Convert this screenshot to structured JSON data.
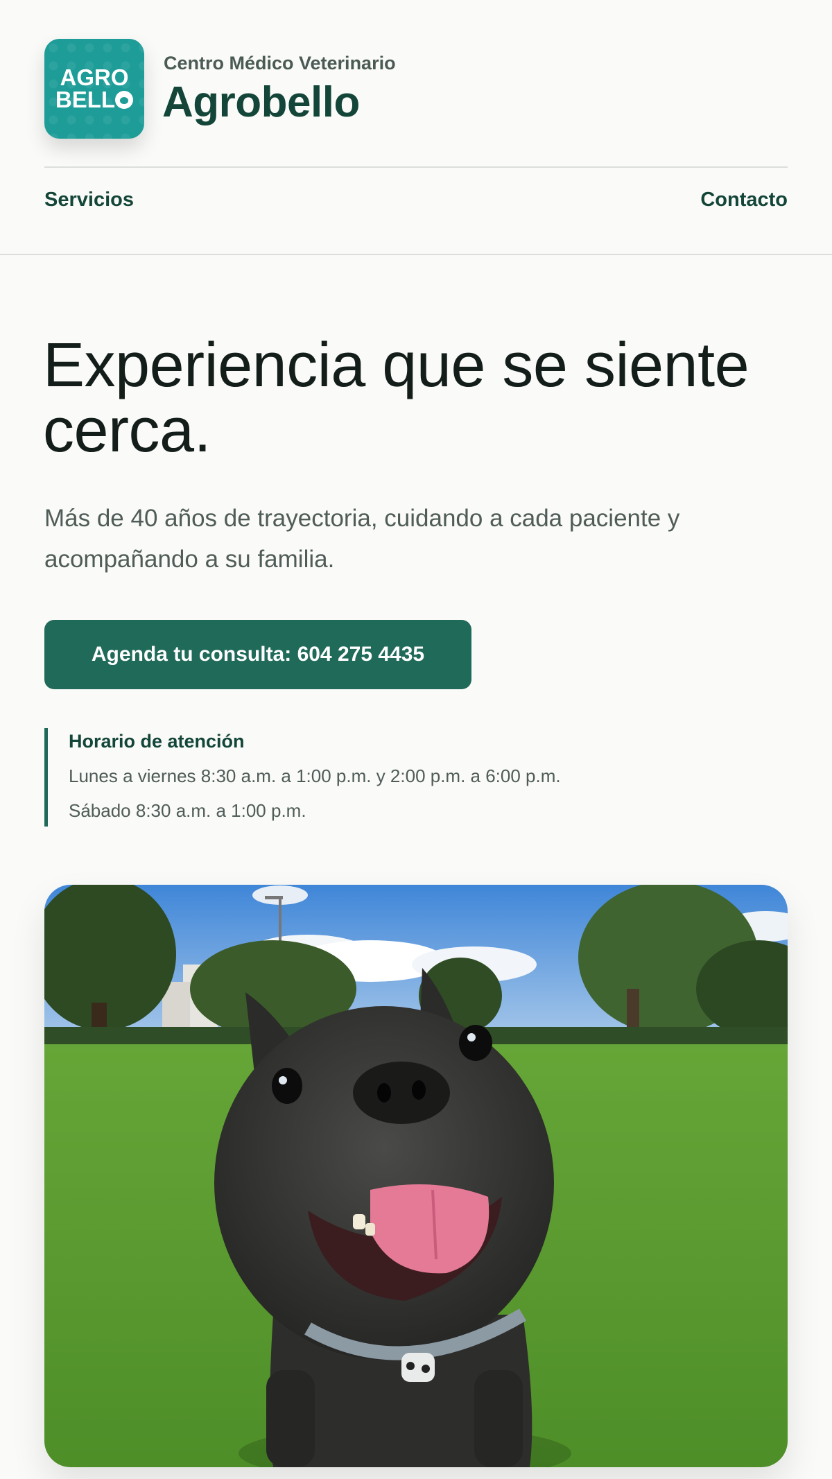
{
  "header": {
    "logo_lines": [
      "AGRO",
      "BELL"
    ],
    "subtitle": "Centro Médico Veterinario",
    "brand": "Agrobello"
  },
  "nav": {
    "left": "Servicios",
    "right": "Contacto"
  },
  "hero": {
    "title": "Experiencia que se siente cerca.",
    "subtitle": "Más de 40 años de trayectoria, cuidando a cada paciente y acompañando a su familia.",
    "cta_label": "Agenda tu consulta: 604 275 4435"
  },
  "hours": {
    "title": "Horario de atención",
    "weekdays": "Lunes a viernes 8:30 a.m. a 1:00 p.m. y 2:00 p.m. a 6:00 p.m.",
    "saturday": "Sábado 8:30 a.m. a 1:00 p.m."
  },
  "colors": {
    "brand_green": "#134638",
    "cta_green": "#206a59",
    "logo_teal": "#1d9c98",
    "background": "#fafaf8"
  },
  "icons": {
    "logo": "paw-icon"
  }
}
